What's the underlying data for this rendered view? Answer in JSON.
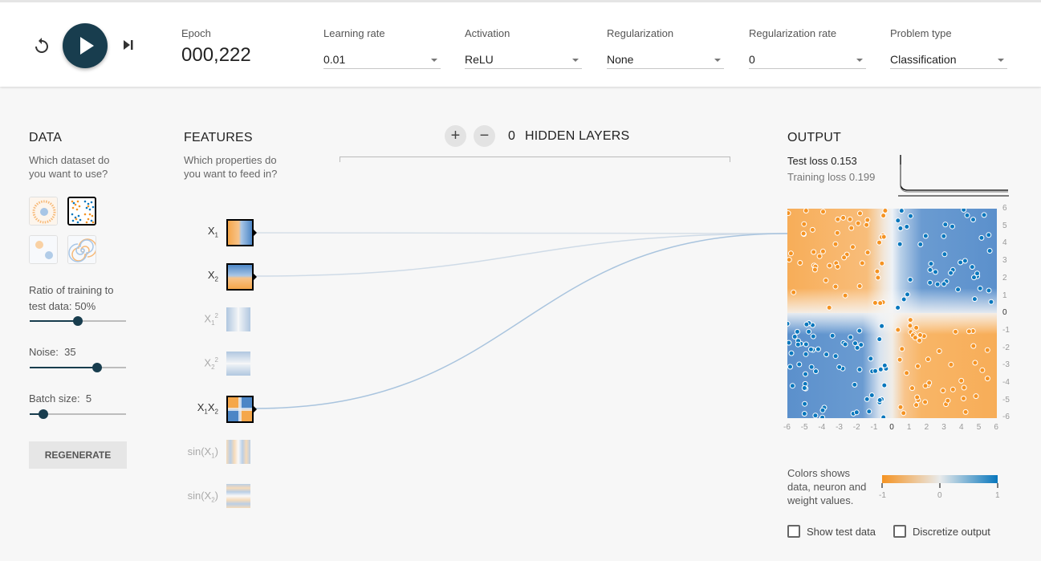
{
  "topbar": {
    "epoch_label": "Epoch",
    "epoch_value": "000,222",
    "controls": [
      {
        "label": "Learning rate",
        "value": "0.01"
      },
      {
        "label": "Activation",
        "value": "ReLU"
      },
      {
        "label": "Regularization",
        "value": "None"
      },
      {
        "label": "Regularization rate",
        "value": "0"
      },
      {
        "label": "Problem type",
        "value": "Classification"
      }
    ]
  },
  "data": {
    "title": "DATA",
    "subtitle": "Which dataset do you want to use?",
    "ratio_label": "Ratio of training to test data:",
    "ratio_value": "50%",
    "ratio_fraction": 0.5,
    "noise_label": "Noise:",
    "noise_value": "35",
    "noise_fraction": 0.7,
    "batch_label": "Batch size:",
    "batch_value": "5",
    "batch_fraction": 0.14,
    "regenerate": "REGENERATE"
  },
  "features": {
    "title": "FEATURES",
    "subtitle": "Which properties do you want to feed in?",
    "items": [
      {
        "base": "X",
        "sub": "1",
        "active": true
      },
      {
        "base": "X",
        "sub": "2",
        "active": true
      },
      {
        "base": "X",
        "sub": "1",
        "sup": "2",
        "active": false
      },
      {
        "base": "X",
        "sub": "2",
        "sup": "2",
        "active": false
      },
      {
        "base": "X",
        "sub": "1",
        "base2": "X",
        "sub2": "2",
        "active": true
      },
      {
        "base": "sin(X",
        "sub": "1",
        "tail": ")",
        "active": false
      },
      {
        "base": "sin(X",
        "sub": "2",
        "tail": ")",
        "active": false
      }
    ]
  },
  "network": {
    "plus": "+",
    "minus": "−",
    "count": "0",
    "label": "HIDDEN LAYERS"
  },
  "output": {
    "title": "OUTPUT",
    "test_loss_label": "Test loss",
    "test_loss_value": "0.153",
    "train_loss_label": "Training loss",
    "train_loss_value": "0.199",
    "y_ticks": [
      "6",
      "5",
      "4",
      "3",
      "2",
      "1",
      "0",
      "-1",
      "-2",
      "-3",
      "-4",
      "-5",
      "-6"
    ],
    "x_ticks": [
      "-6",
      "-5",
      "-4",
      "-3",
      "-2",
      "-1",
      "0",
      "1",
      "2",
      "3",
      "4",
      "5",
      "6"
    ],
    "legend_text": "Colors shows data, neuron and weight values.",
    "legend_ticks": [
      "-1",
      "0",
      "1"
    ],
    "show_test_data": "Show test data",
    "discretize_output": "Discretize output"
  },
  "colors": {
    "orange": "#f59322",
    "blue": "#0877bd",
    "dark": "#183d4e"
  }
}
